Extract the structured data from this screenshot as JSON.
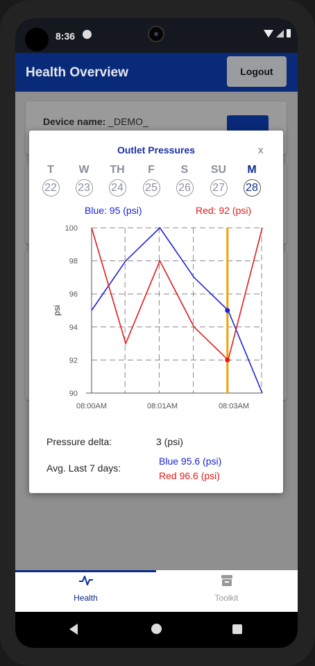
{
  "status_bar": {
    "time": "8:36"
  },
  "app_bar": {
    "title": "Health Overview",
    "logout_label": "Logout"
  },
  "device": {
    "label": "Device name:",
    "value": "_DEMO_"
  },
  "dialog": {
    "title": "Outlet Pressures",
    "close_label": "x",
    "days": [
      {
        "name": "T",
        "date": "22"
      },
      {
        "name": "W",
        "date": "23"
      },
      {
        "name": "TH",
        "date": "24"
      },
      {
        "name": "F",
        "date": "25"
      },
      {
        "name": "S",
        "date": "26"
      },
      {
        "name": "SU",
        "date": "27"
      },
      {
        "name": "M",
        "date": "28",
        "selected": true
      }
    ],
    "legend_blue": "Blue: 95 (psi)",
    "legend_red": "Red: 92 (psi)",
    "pressure_delta_label": "Pressure delta:",
    "pressure_delta_value": "3 (psi)",
    "avg_label": "Avg. Last 7 days:",
    "avg_blue": "Blue 95.6 (psi)",
    "avg_red": "Red 96.6 (psi)"
  },
  "chart_data": {
    "type": "line",
    "ylabel": "psi",
    "ylim": [
      90,
      100
    ],
    "yticks": [
      90,
      92,
      94,
      96,
      98,
      100
    ],
    "xtick_labels": [
      "08:00AM",
      "08:01AM",
      "08:03AM"
    ],
    "grid": true,
    "x": [
      0,
      1,
      2,
      3,
      4,
      5
    ],
    "series": [
      {
        "name": "Blue",
        "color": "#1c23d6",
        "values": [
          95,
          98,
          100,
          97,
          95,
          90
        ]
      },
      {
        "name": "Red",
        "color": "#e01b1b",
        "values": [
          100,
          93,
          98,
          94,
          92,
          100
        ]
      }
    ],
    "cursor_index": 4,
    "cursor_color": "#f5a000"
  },
  "bottom_nav": {
    "items": [
      {
        "label": "Health",
        "icon": "pulse-icon"
      },
      {
        "label": "Toolkit",
        "icon": "archive-icon"
      }
    ]
  }
}
